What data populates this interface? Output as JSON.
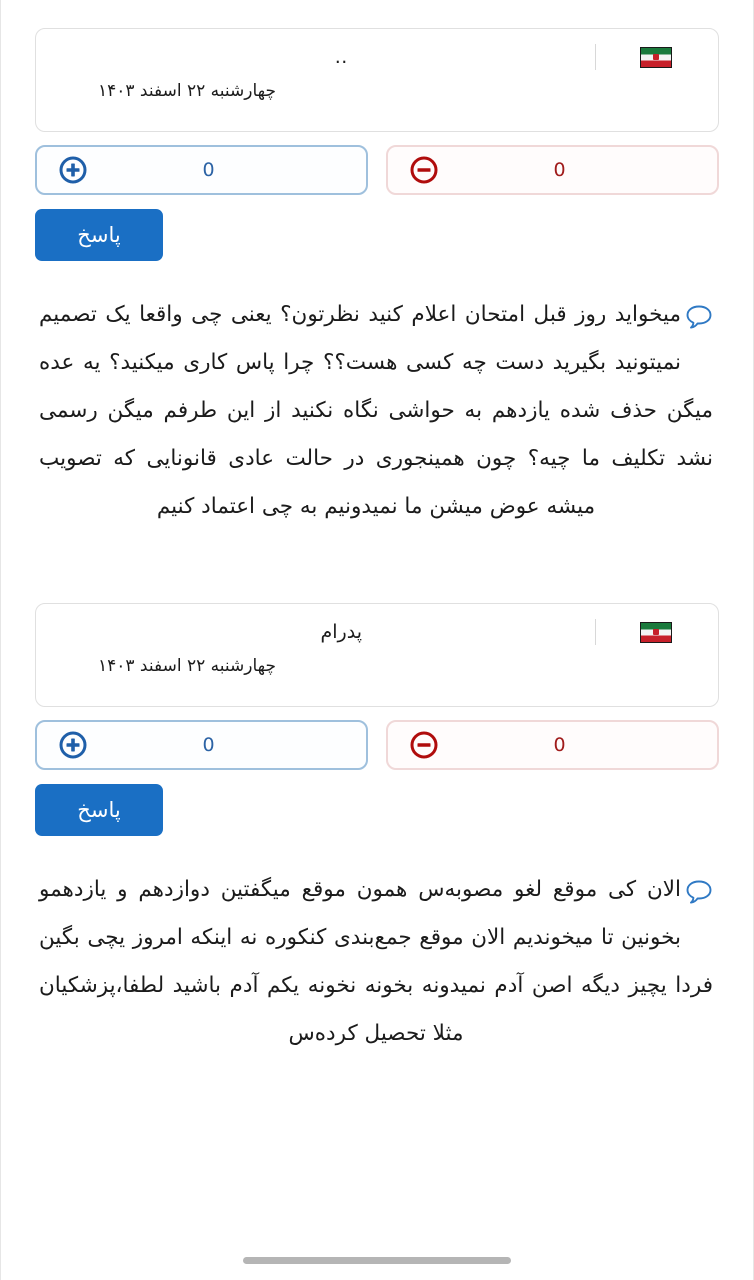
{
  "page": {
    "direction": "rtl",
    "accent_blue": "#1a6fc4",
    "vote_up_color": "#2c63a5",
    "vote_down_color": "#a01c1c",
    "home_indicator_color": "#b5b5b5"
  },
  "comments": [
    {
      "author": "..",
      "date": "چهارشنبه ۲۲ اسفند ۱۴۰۳",
      "flag_icon": "iran-flag-icon",
      "upvote_icon": "plus-circle-icon",
      "upvotes": "0",
      "downvote_icon": "minus-circle-icon",
      "downvotes": "0",
      "reply_label": "پاسخ",
      "bubble_icon": "speech-bubble-icon",
      "text": "میخواید روز قبل امتحان اعلام کنید نظرتون؟ یعنی چی واقعا یک تصمیم نمیتونید بگیرید دست چه کسی هست؟؟ چرا پاس کاری میکنید؟ یه عده میگن حذف شده یازدهم به حواشی نگاه نکنید از این طرفم میگن رسمی نشد تکلیف ما چیه؟ چون همینجوری در حالت عادی قانونایی که تصویب میشه عوض میشن ما نمیدونیم به چی اعتماد کنیم"
    },
    {
      "author": "پدرام",
      "date": "چهارشنبه ۲۲ اسفند ۱۴۰۳",
      "flag_icon": "iran-flag-icon",
      "upvote_icon": "plus-circle-icon",
      "upvotes": "0",
      "downvote_icon": "minus-circle-icon",
      "downvotes": "0",
      "reply_label": "پاسخ",
      "bubble_icon": "speech-bubble-icon",
      "text": "الان کی موقع لغو مصوبه‌س همون موقع میگفتین دوازدهم و یازدهمو بخونین تا میخوندیم الان موقع جمع‌بندی کنکوره نه اینکه امروز یچی بگین فردا یچیز دیگه اصن آدم نمیدونه بخونه نخونه یکم آدم باشید لطفا،پزشکیان مثلا تحصیل کرده‌س"
    }
  ]
}
